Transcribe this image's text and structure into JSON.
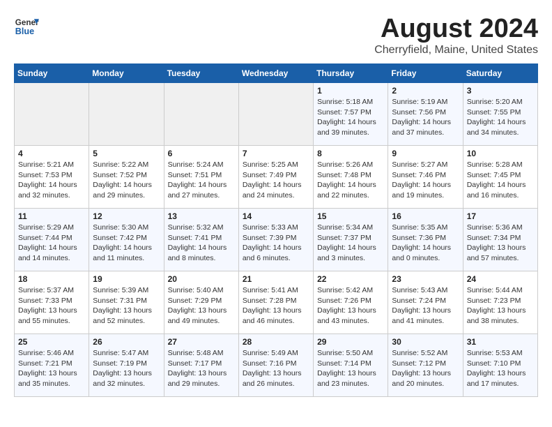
{
  "logo": {
    "line1": "General",
    "line2": "Blue"
  },
  "title": "August 2024",
  "subtitle": "Cherryfield, Maine, United States",
  "weekdays": [
    "Sunday",
    "Monday",
    "Tuesday",
    "Wednesday",
    "Thursday",
    "Friday",
    "Saturday"
  ],
  "weeks": [
    [
      {
        "day": "",
        "info": ""
      },
      {
        "day": "",
        "info": ""
      },
      {
        "day": "",
        "info": ""
      },
      {
        "day": "",
        "info": ""
      },
      {
        "day": "1",
        "info": "Sunrise: 5:18 AM\nSunset: 7:57 PM\nDaylight: 14 hours\nand 39 minutes."
      },
      {
        "day": "2",
        "info": "Sunrise: 5:19 AM\nSunset: 7:56 PM\nDaylight: 14 hours\nand 37 minutes."
      },
      {
        "day": "3",
        "info": "Sunrise: 5:20 AM\nSunset: 7:55 PM\nDaylight: 14 hours\nand 34 minutes."
      }
    ],
    [
      {
        "day": "4",
        "info": "Sunrise: 5:21 AM\nSunset: 7:53 PM\nDaylight: 14 hours\nand 32 minutes."
      },
      {
        "day": "5",
        "info": "Sunrise: 5:22 AM\nSunset: 7:52 PM\nDaylight: 14 hours\nand 29 minutes."
      },
      {
        "day": "6",
        "info": "Sunrise: 5:24 AM\nSunset: 7:51 PM\nDaylight: 14 hours\nand 27 minutes."
      },
      {
        "day": "7",
        "info": "Sunrise: 5:25 AM\nSunset: 7:49 PM\nDaylight: 14 hours\nand 24 minutes."
      },
      {
        "day": "8",
        "info": "Sunrise: 5:26 AM\nSunset: 7:48 PM\nDaylight: 14 hours\nand 22 minutes."
      },
      {
        "day": "9",
        "info": "Sunrise: 5:27 AM\nSunset: 7:46 PM\nDaylight: 14 hours\nand 19 minutes."
      },
      {
        "day": "10",
        "info": "Sunrise: 5:28 AM\nSunset: 7:45 PM\nDaylight: 14 hours\nand 16 minutes."
      }
    ],
    [
      {
        "day": "11",
        "info": "Sunrise: 5:29 AM\nSunset: 7:44 PM\nDaylight: 14 hours\nand 14 minutes."
      },
      {
        "day": "12",
        "info": "Sunrise: 5:30 AM\nSunset: 7:42 PM\nDaylight: 14 hours\nand 11 minutes."
      },
      {
        "day": "13",
        "info": "Sunrise: 5:32 AM\nSunset: 7:41 PM\nDaylight: 14 hours\nand 8 minutes."
      },
      {
        "day": "14",
        "info": "Sunrise: 5:33 AM\nSunset: 7:39 PM\nDaylight: 14 hours\nand 6 minutes."
      },
      {
        "day": "15",
        "info": "Sunrise: 5:34 AM\nSunset: 7:37 PM\nDaylight: 14 hours\nand 3 minutes."
      },
      {
        "day": "16",
        "info": "Sunrise: 5:35 AM\nSunset: 7:36 PM\nDaylight: 14 hours\nand 0 minutes."
      },
      {
        "day": "17",
        "info": "Sunrise: 5:36 AM\nSunset: 7:34 PM\nDaylight: 13 hours\nand 57 minutes."
      }
    ],
    [
      {
        "day": "18",
        "info": "Sunrise: 5:37 AM\nSunset: 7:33 PM\nDaylight: 13 hours\nand 55 minutes."
      },
      {
        "day": "19",
        "info": "Sunrise: 5:39 AM\nSunset: 7:31 PM\nDaylight: 13 hours\nand 52 minutes."
      },
      {
        "day": "20",
        "info": "Sunrise: 5:40 AM\nSunset: 7:29 PM\nDaylight: 13 hours\nand 49 minutes."
      },
      {
        "day": "21",
        "info": "Sunrise: 5:41 AM\nSunset: 7:28 PM\nDaylight: 13 hours\nand 46 minutes."
      },
      {
        "day": "22",
        "info": "Sunrise: 5:42 AM\nSunset: 7:26 PM\nDaylight: 13 hours\nand 43 minutes."
      },
      {
        "day": "23",
        "info": "Sunrise: 5:43 AM\nSunset: 7:24 PM\nDaylight: 13 hours\nand 41 minutes."
      },
      {
        "day": "24",
        "info": "Sunrise: 5:44 AM\nSunset: 7:23 PM\nDaylight: 13 hours\nand 38 minutes."
      }
    ],
    [
      {
        "day": "25",
        "info": "Sunrise: 5:46 AM\nSunset: 7:21 PM\nDaylight: 13 hours\nand 35 minutes."
      },
      {
        "day": "26",
        "info": "Sunrise: 5:47 AM\nSunset: 7:19 PM\nDaylight: 13 hours\nand 32 minutes."
      },
      {
        "day": "27",
        "info": "Sunrise: 5:48 AM\nSunset: 7:17 PM\nDaylight: 13 hours\nand 29 minutes."
      },
      {
        "day": "28",
        "info": "Sunrise: 5:49 AM\nSunset: 7:16 PM\nDaylight: 13 hours\nand 26 minutes."
      },
      {
        "day": "29",
        "info": "Sunrise: 5:50 AM\nSunset: 7:14 PM\nDaylight: 13 hours\nand 23 minutes."
      },
      {
        "day": "30",
        "info": "Sunrise: 5:52 AM\nSunset: 7:12 PM\nDaylight: 13 hours\nand 20 minutes."
      },
      {
        "day": "31",
        "info": "Sunrise: 5:53 AM\nSunset: 7:10 PM\nDaylight: 13 hours\nand 17 minutes."
      }
    ]
  ]
}
